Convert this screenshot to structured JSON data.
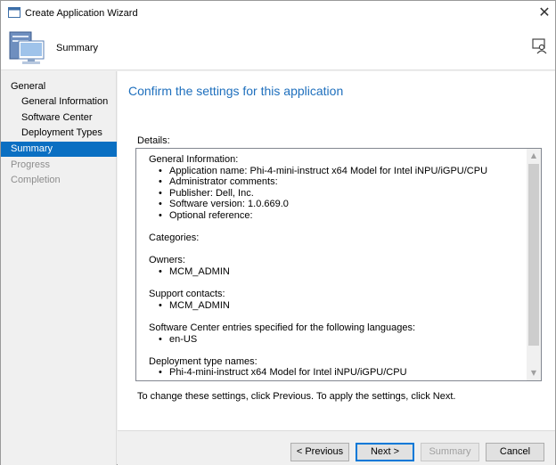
{
  "window": {
    "title": "Create Application Wizard",
    "close_glyph": "✕"
  },
  "header": {
    "title": "Summary",
    "icon": "computer-wizard-icon",
    "help_icon": "help-person-icon"
  },
  "nav": {
    "items": [
      {
        "label": "General",
        "level": "top",
        "state": "normal"
      },
      {
        "label": "General Information",
        "level": "sub",
        "state": "normal"
      },
      {
        "label": "Software Center",
        "level": "sub",
        "state": "normal"
      },
      {
        "label": "Deployment Types",
        "level": "sub",
        "state": "normal"
      },
      {
        "label": "Summary",
        "level": "top",
        "state": "active"
      },
      {
        "label": "Progress",
        "level": "top",
        "state": "disabled"
      },
      {
        "label": "Completion",
        "level": "top",
        "state": "disabled"
      }
    ]
  },
  "content": {
    "heading": "Confirm the settings for this application",
    "details_label": "Details:",
    "details": [
      {
        "text": "General Information:",
        "bullet": false
      },
      {
        "text": "Application name: Phi-4-mini-instruct x64 Model for Intel iNPU/iGPU/CPU",
        "bullet": true
      },
      {
        "text": "Administrator comments:",
        "bullet": true
      },
      {
        "text": "Publisher: Dell, Inc.",
        "bullet": true
      },
      {
        "text": "Software version: 1.0.669.0",
        "bullet": true
      },
      {
        "text": "Optional reference:",
        "bullet": true
      },
      {
        "text": "",
        "bullet": false
      },
      {
        "text": "Categories:",
        "bullet": false
      },
      {
        "text": "",
        "bullet": false
      },
      {
        "text": "Owners:",
        "bullet": false
      },
      {
        "text": "MCM_ADMIN",
        "bullet": true
      },
      {
        "text": "",
        "bullet": false
      },
      {
        "text": "Support contacts:",
        "bullet": false
      },
      {
        "text": "MCM_ADMIN",
        "bullet": true
      },
      {
        "text": "",
        "bullet": false
      },
      {
        "text": "Software Center entries specified for the following languages:",
        "bullet": false
      },
      {
        "text": "en-US",
        "bullet": true
      },
      {
        "text": "",
        "bullet": false
      },
      {
        "text": "Deployment type names:",
        "bullet": false
      },
      {
        "text": "Phi-4-mini-instruct x64 Model for Intel iNPU/iGPU/CPU",
        "bullet": true
      }
    ],
    "instruction": "To change these settings, click Previous. To apply the settings, click Next."
  },
  "footer": {
    "previous_label": "< Previous",
    "next_label": "Next >",
    "summary_label": "Summary",
    "cancel_label": "Cancel"
  },
  "colors": {
    "accent": "#0a6fc2",
    "heading": "#1e6fbd"
  }
}
